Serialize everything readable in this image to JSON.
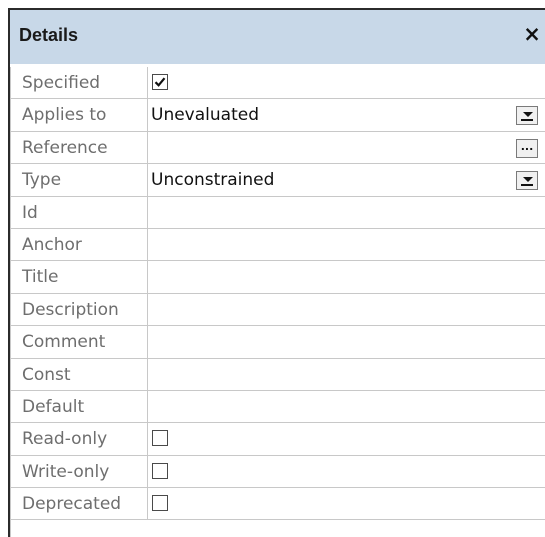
{
  "panel": {
    "title": "Details",
    "close_glyph": "×"
  },
  "properties": [
    {
      "label": "Specified",
      "kind": "checkbox",
      "checked": true
    },
    {
      "label": "Applies to",
      "kind": "dropdown",
      "value": "Unevaluated"
    },
    {
      "label": "Reference",
      "kind": "ellipsis",
      "value": "",
      "button": "..."
    },
    {
      "label": "Type",
      "kind": "dropdown",
      "value": "Unconstrained"
    },
    {
      "label": "Id",
      "kind": "text",
      "value": ""
    },
    {
      "label": "Anchor",
      "kind": "text",
      "value": ""
    },
    {
      "label": "Title",
      "kind": "text",
      "value": ""
    },
    {
      "label": "Description",
      "kind": "text",
      "value": ""
    },
    {
      "label": "Comment",
      "kind": "text",
      "value": ""
    },
    {
      "label": "Const",
      "kind": "text",
      "value": ""
    },
    {
      "label": "Default",
      "kind": "text",
      "value": ""
    },
    {
      "label": "Read-only",
      "kind": "checkbox",
      "checked": false
    },
    {
      "label": "Write-only",
      "kind": "checkbox",
      "checked": false
    },
    {
      "label": "Deprecated",
      "kind": "checkbox",
      "checked": false
    }
  ],
  "icons": {
    "close": "close-icon",
    "dropdown": "chevron-down-icon",
    "checkmark": "checkmark-icon"
  }
}
